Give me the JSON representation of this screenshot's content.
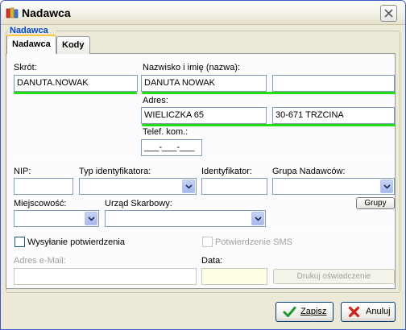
{
  "window": {
    "title": "Nadawca",
    "app_icon": "books-icon",
    "close_icon": "close-icon"
  },
  "groupbox": {
    "label": "Nadawca"
  },
  "tabs": [
    {
      "label": "Nadawca",
      "active": true
    },
    {
      "label": "Kody",
      "active": false
    }
  ],
  "form": {
    "skrot_label": "Skrót:",
    "skrot_value": "DANUTA.NOWAK",
    "nazwisko_label": "Nazwisko i imię (nazwa):",
    "nazwisko_value": "DANUTA NOWAK",
    "nazwisko2_value": "",
    "adres_label": "Adres:",
    "adres_value": "WIELICZKA 65",
    "adres2_value": "30-671 TRZCINA",
    "telefon_label": "Telef. kom.:",
    "telefon_value": "___-___-___",
    "nip_label": "NIP:",
    "nip_value": "",
    "typ_label": "Typ identyfikatora:",
    "typ_value": "",
    "ident_label": "Identyfikator:",
    "ident_value": "",
    "grupa_label": "Grupa Nadawców:",
    "grupa_value": "",
    "grupy_button": "Grupy",
    "miejscowosc_label": "Miejscowość:",
    "miejscowosc_value": "",
    "urzad_label": "Urząd Skarbowy:",
    "urzad_value": "",
    "wysylanie_label": "Wysyłanie potwierdzenia",
    "wysylanie_checked": false,
    "sms_label": "Potwierdzenie SMS",
    "sms_checked": false,
    "email_label": "Adres e-Mail:",
    "email_value": "",
    "data_label": "Data:",
    "data_value": "",
    "drukuj_button": "Drukuj oświadczenie"
  },
  "footer": {
    "zapisz_label": "Zapisz",
    "zapisz_icon": "checkmark-icon",
    "anuluj_label": "Anuluj",
    "anuluj_icon": "red-x-icon"
  },
  "colors": {
    "highlight_underline": "#22dd11",
    "groupbox_title": "#0046d5",
    "tab_accent": "#ffc83c"
  }
}
